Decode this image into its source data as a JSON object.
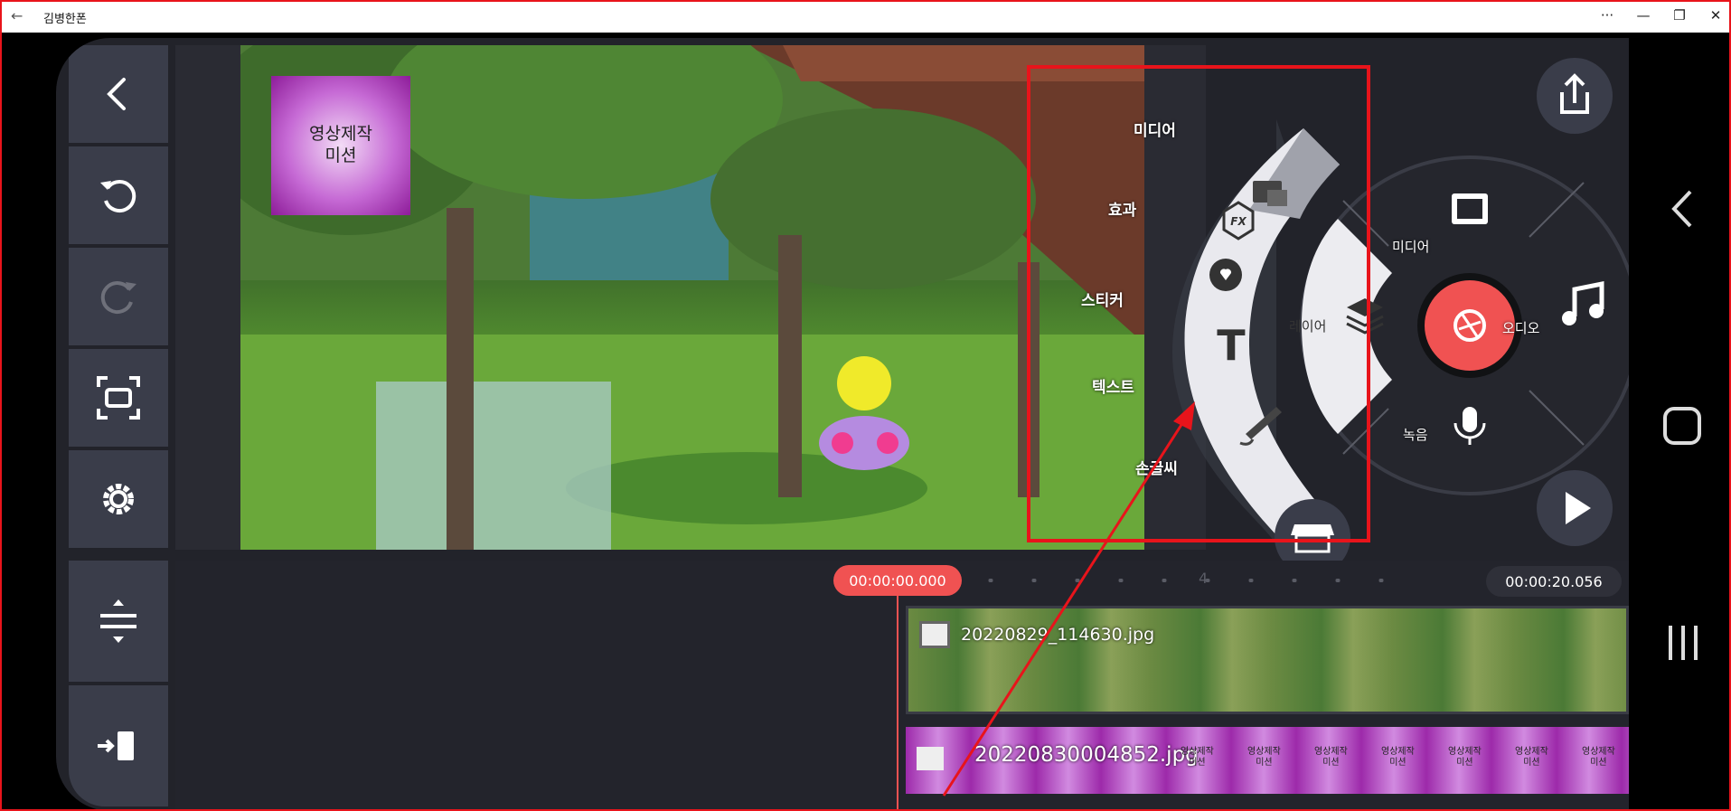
{
  "window": {
    "title": "김병한폰",
    "back_glyph": "←",
    "more_glyph": "···",
    "minimize_glyph": "—",
    "restore_glyph": "❐",
    "close_glyph": "✕"
  },
  "preview": {
    "sticker_text_line1": "영상제작",
    "sticker_text_line2": "미션"
  },
  "side_menu": {
    "items": [
      {
        "label": "미디어",
        "icon": "media-image-icon"
      },
      {
        "label": "효과",
        "icon": "fx-icon"
      },
      {
        "label": "스티커",
        "icon": "sticker-icon"
      },
      {
        "label": "텍스트",
        "icon": "text-icon"
      },
      {
        "label": "손글씨",
        "icon": "handwriting-icon"
      }
    ],
    "store_icon": "store-icon"
  },
  "wheel": {
    "media_label": "미디어",
    "audio_label": "오디오",
    "record_label": "녹음",
    "layer_label": "레이어",
    "center_icon": "shutter-icon"
  },
  "timeline": {
    "current_time": "00:00:00.000",
    "total_time": "00:00:20.056",
    "ruler_mark": "4",
    "clips": [
      {
        "name": "20220829_114630.jpg",
        "type": "video"
      },
      {
        "name": "20220830004852.jpg",
        "type": "image"
      }
    ],
    "overlay_tile_line1": "영상제작",
    "overlay_tile_line2": "미션"
  },
  "colors": {
    "accent_red": "#f05252",
    "annotation_red": "#e8141b",
    "panel": "#3a3d4a",
    "background": "#22232a",
    "clip_purple": "#b13fbf"
  }
}
